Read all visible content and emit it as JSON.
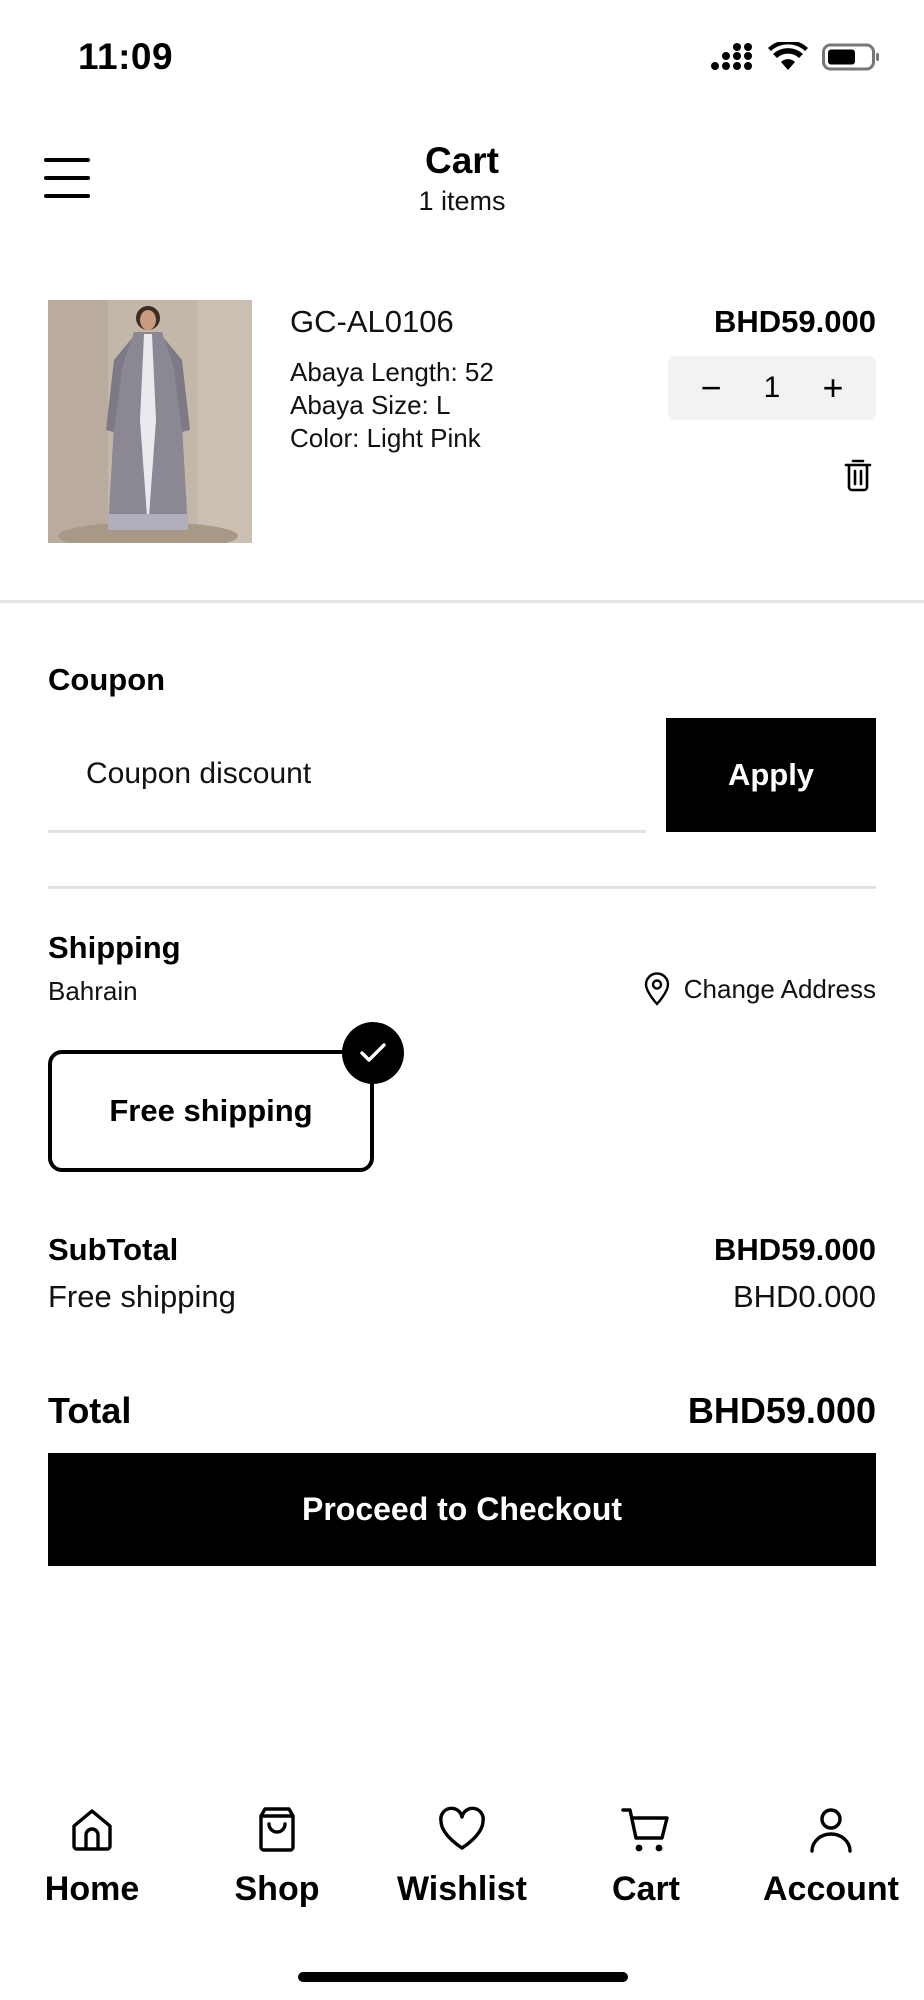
{
  "status_bar": {
    "time": "11:09",
    "icons": [
      "cellular-signal-icon",
      "wifi-icon",
      "battery-icon"
    ]
  },
  "header": {
    "title": "Cart",
    "subtitle": "1 items",
    "menu_icon": "hamburger-menu-icon"
  },
  "cart_items": [
    {
      "sku": "GC-AL0106",
      "attributes": [
        "Abaya Length: 52",
        "Abaya Size: L",
        "Color: Light Pink"
      ],
      "price": "BHD59.000",
      "quantity": "1",
      "decrement": "−",
      "increment": "+",
      "delete_icon": "trash-icon"
    }
  ],
  "coupon": {
    "label": "Coupon",
    "placeholder": "Coupon discount",
    "apply_label": "Apply"
  },
  "shipping": {
    "label": "Shipping",
    "country": "Bahrain",
    "change_address_label": "Change Address",
    "change_address_icon": "location-pin-icon",
    "option_label": "Free shipping",
    "option_selected": true
  },
  "totals": {
    "subtotal_label": "SubTotal",
    "subtotal_value": "BHD59.000",
    "shipping_label": "Free shipping",
    "shipping_value": "BHD0.000",
    "total_label": "Total",
    "total_value": "BHD59.000"
  },
  "checkout": {
    "label": "Proceed to Checkout"
  },
  "bottom_nav": [
    {
      "label": "Home",
      "icon": "home-icon"
    },
    {
      "label": "Shop",
      "icon": "shopping-bag-icon"
    },
    {
      "label": "Wishlist",
      "icon": "heart-icon"
    },
    {
      "label": "Cart",
      "icon": "cart-icon"
    },
    {
      "label": "Account",
      "icon": "user-icon"
    }
  ]
}
